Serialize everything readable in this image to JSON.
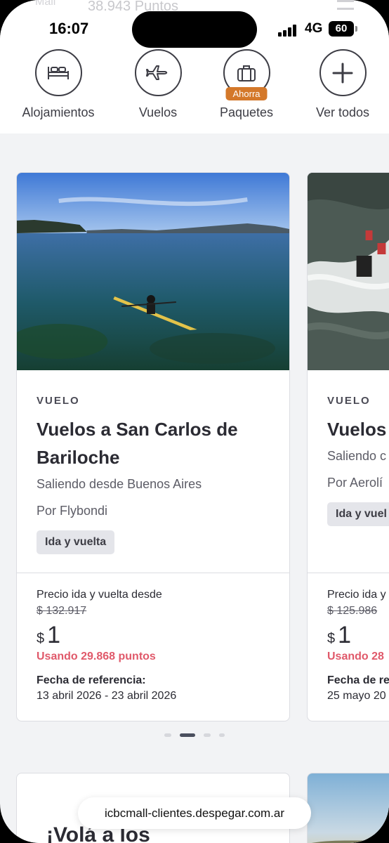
{
  "ghost": {
    "mall": "Mall",
    "amount": "38.943 Puntos"
  },
  "status": {
    "time": "16:07",
    "network": "4G",
    "battery": "60"
  },
  "categories": [
    {
      "label": "Alojamientos",
      "icon": "bed-icon"
    },
    {
      "label": "Vuelos",
      "icon": "plane-icon"
    },
    {
      "label": "Paquetes",
      "icon": "suitcase-icon",
      "badge": "Ahorra"
    },
    {
      "label": "Ver todos",
      "icon": "plus-icon"
    }
  ],
  "cards": [
    {
      "kind": "VUELO",
      "title_line1": "Vuelos a San Carlos de",
      "title_line2": "Bariloche",
      "origin": "Saliendo desde Buenos Aires",
      "airline": "Por Flybondi",
      "chip": "Ida y vuelta",
      "price_label": "Precio ida y vuelta desde",
      "old_price": "$ 132.917",
      "currency": "$",
      "price": "1",
      "points": "Usando 29.868 puntos",
      "date_label": "Fecha de referencia:",
      "dates": "13 abril 2026 - 23 abril 2026"
    },
    {
      "kind": "VUELO",
      "title_line1": "Vuelos",
      "origin": "Saliendo c",
      "airline": "Por Aerolí",
      "chip": "Ida y vuel",
      "price_label": "Precio ida y",
      "old_price": "$ 125.986",
      "currency": "$",
      "price": "1",
      "points": "Usando 28",
      "date_label": "Fecha de re",
      "dates": "25 mayo 20"
    }
  ],
  "carousel": {
    "active_index": 1,
    "count": 4
  },
  "promo": {
    "title": "¡Volá a los"
  },
  "browser": {
    "url": "icbcmall-clientes.despegar.com.ar"
  },
  "colors": {
    "accent_badge": "#d4782a",
    "points_red": "#e0596a",
    "text_dark": "#2b2b33"
  }
}
